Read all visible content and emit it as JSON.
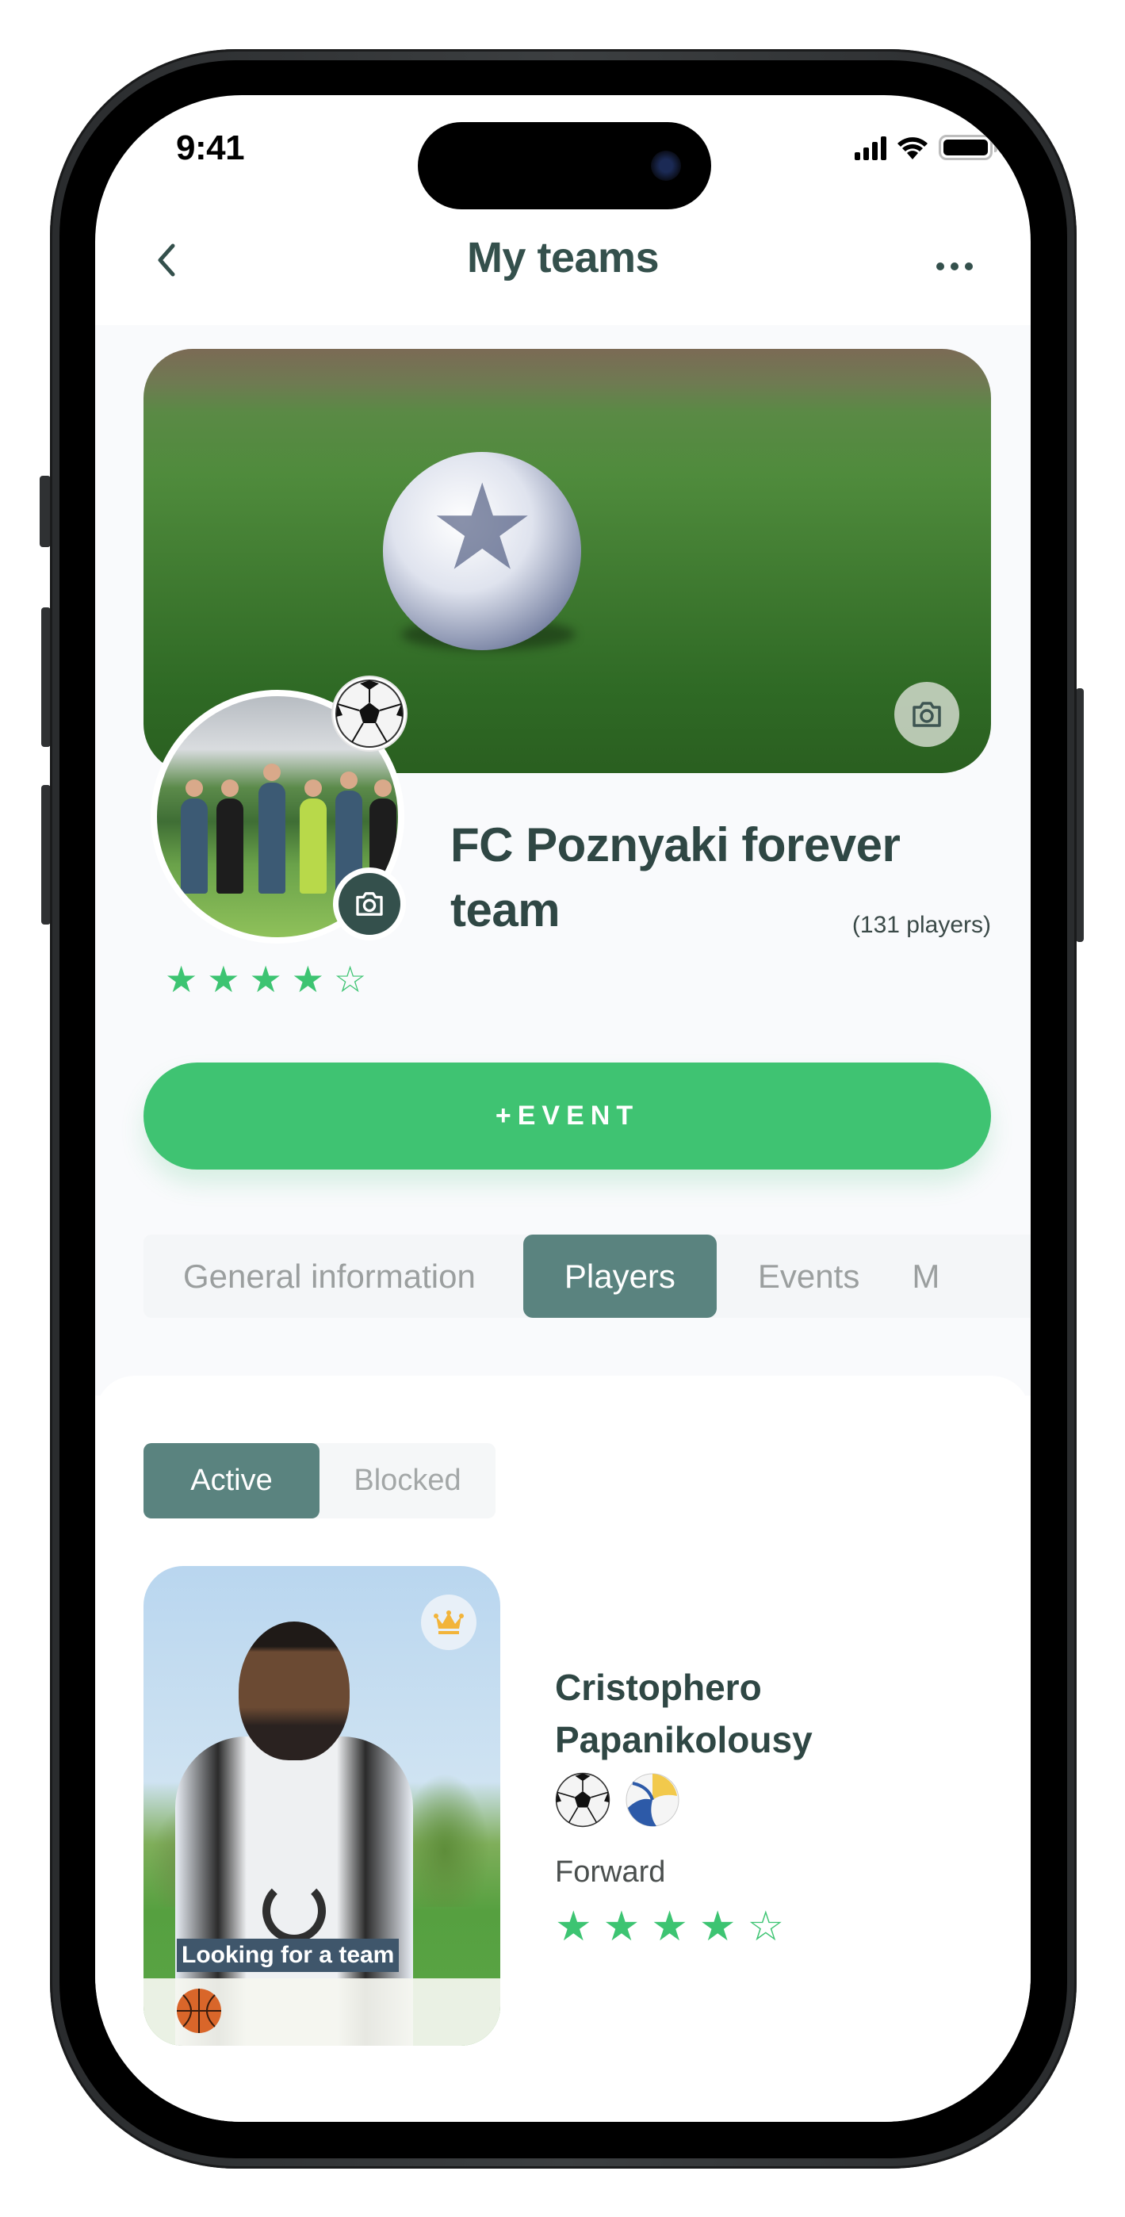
{
  "status_bar": {
    "time": "9:41",
    "icons": [
      "cellular-signal-icon",
      "wifi-icon",
      "battery-icon"
    ]
  },
  "header": {
    "title": "My teams",
    "back_icon": "chevron-left-icon",
    "back_glyph": "‹",
    "more_icon": "more-horizontal-icon",
    "more_glyph": "•••"
  },
  "team": {
    "name": "FC Poznyaki forever team",
    "players_count": "(131 players)",
    "rating": 4,
    "rating_max": 5,
    "sport_icon": "soccer-ball-icon",
    "cover_camera_icon": "camera-icon",
    "avatar_camera_icon": "camera-icon"
  },
  "actions": {
    "event_button": "+EVENT"
  },
  "tabs": [
    {
      "label": "General information",
      "active": false
    },
    {
      "label": "Players",
      "active": true
    },
    {
      "label": "Events",
      "active": false
    },
    {
      "label": "M",
      "active": false
    }
  ],
  "segment": [
    {
      "label": "Active",
      "active": true
    },
    {
      "label": "Blocked",
      "active": false
    }
  ],
  "players": [
    {
      "name_line1": "Cristophero",
      "name_line2": "Papanikolousy",
      "sports": [
        "soccer-ball-icon",
        "volleyball-icon"
      ],
      "position": "Forward",
      "rating": 4,
      "rating_max": 5,
      "badge": "Looking for a team",
      "captain_icon": "crown-icon",
      "extra_sport_icon": "basketball-icon"
    }
  ],
  "colors": {
    "primary_green": "#3fc372",
    "teal": "#5a837f",
    "dark_text": "#2f4744",
    "star": "#3dc472",
    "crown": "#f2b43a",
    "badge_bg": "#3f566b"
  }
}
